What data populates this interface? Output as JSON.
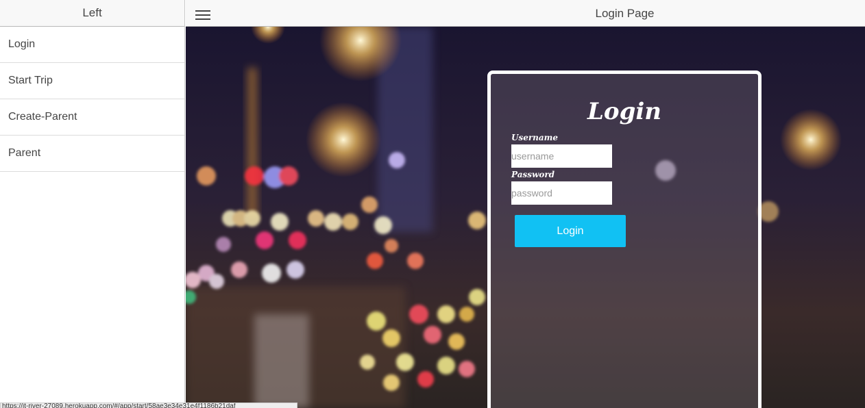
{
  "left_pane": {
    "title": "Left",
    "menu": [
      {
        "label": "Login"
      },
      {
        "label": "Start Trip"
      },
      {
        "label": "Create-Parent"
      },
      {
        "label": "Parent"
      }
    ]
  },
  "header": {
    "title": "Login Page",
    "menu_icon": "hamburger-icon"
  },
  "login_card": {
    "title": "Login",
    "username_label": "Username",
    "username_placeholder": "username",
    "password_label": "Password",
    "password_placeholder": "password",
    "button_label": "Login"
  },
  "colors": {
    "accent": "#11c1f3",
    "header_bg": "#f8f8f8"
  },
  "status_bar": {
    "text": "https://jt-river-27089.herokuapp.com/#/app/start/58ae3e34e31e4f1186b21daf"
  }
}
